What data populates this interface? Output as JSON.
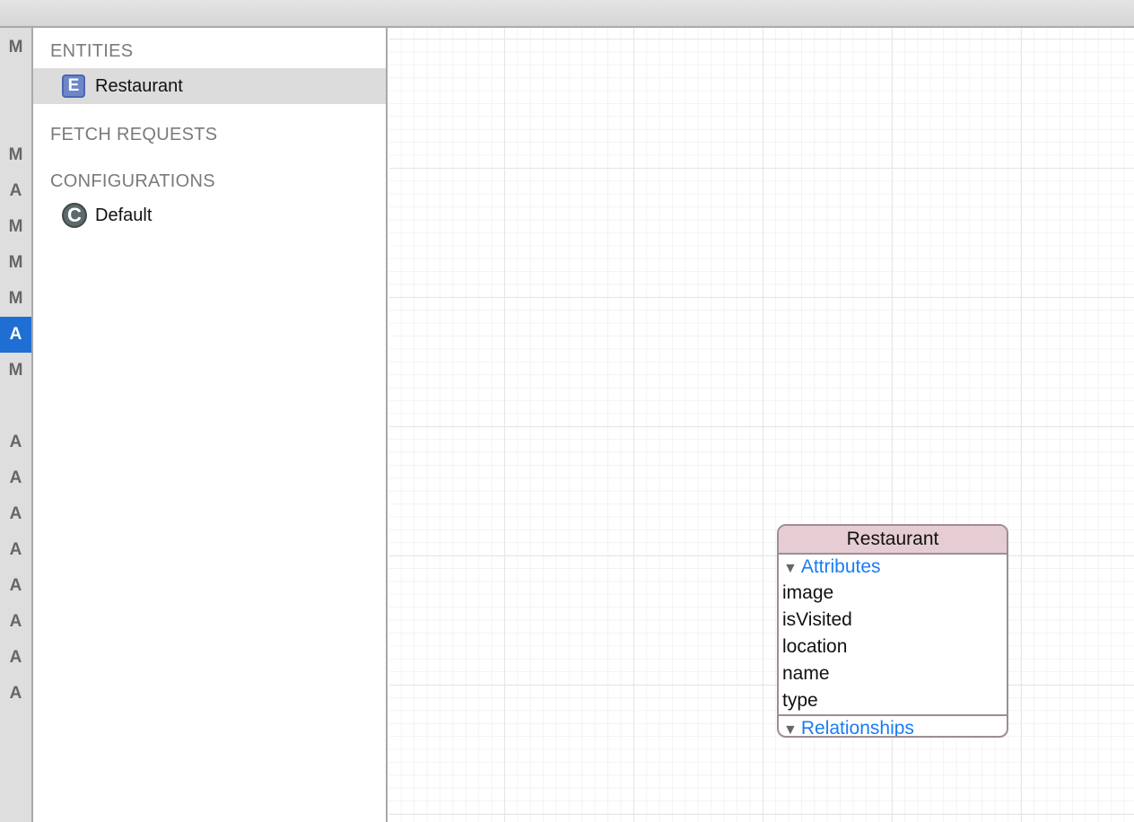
{
  "gutter": {
    "letters": [
      "M",
      "M",
      "A",
      "M",
      "M",
      "M",
      "A",
      "M",
      "A",
      "A",
      "A",
      "A",
      "A",
      "A",
      "A",
      "A"
    ],
    "selected_index": 6
  },
  "navigator": {
    "entities_header": "ENTITIES",
    "entities": [
      {
        "label": "Restaurant",
        "icon": "entity-icon",
        "icon_letter": "E",
        "selected": true
      }
    ],
    "fetch_requests_header": "FETCH REQUESTS",
    "configurations_header": "CONFIGURATIONS",
    "configurations": [
      {
        "label": "Default",
        "icon": "configuration-icon",
        "icon_letter": "C"
      }
    ]
  },
  "diagram": {
    "entity": {
      "title": "Restaurant",
      "attributes_label": "Attributes",
      "attributes": [
        "image",
        "isVisited",
        "location",
        "name",
        "type"
      ],
      "relationships_label": "Relationships",
      "disclosure": "▼"
    }
  },
  "colors": {
    "selection": "#1f6ed4",
    "entity_header": "#e5cdd3",
    "group_label": "#1a7cf5"
  }
}
